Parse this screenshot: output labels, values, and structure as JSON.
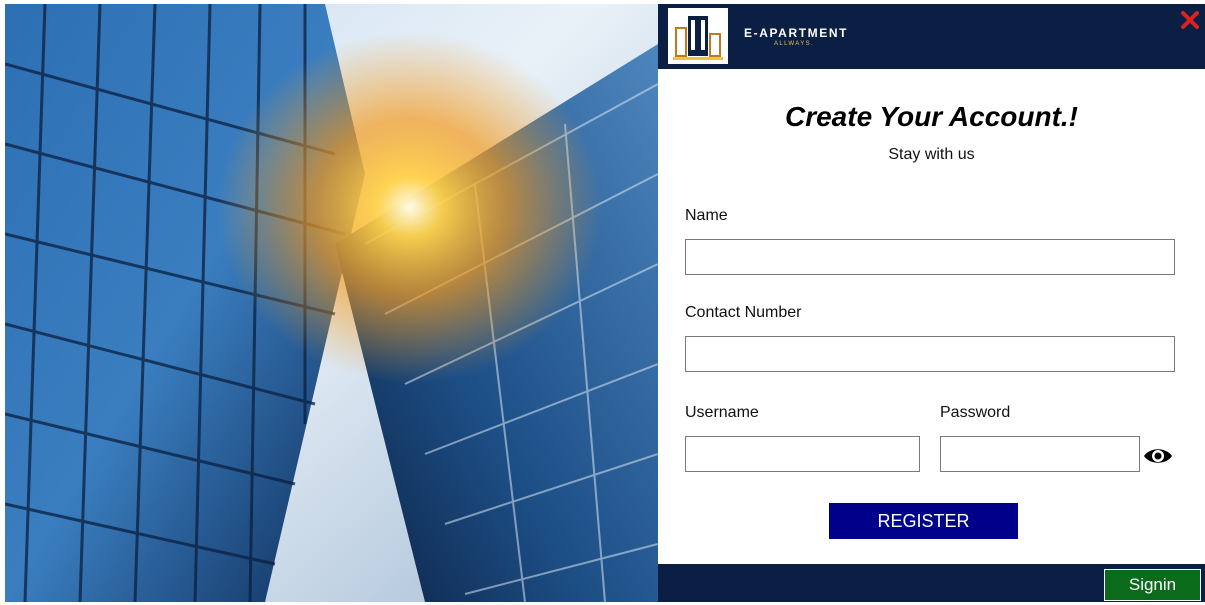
{
  "brand": {
    "name": "E-APARTMENT",
    "tagline": "ALLWAYS."
  },
  "form": {
    "title": "Create Your Account.!",
    "subtitle": "Stay with us",
    "name_label": "Name",
    "name_value": "",
    "contact_label": "Contact Number",
    "contact_value": "",
    "username_label": "Username",
    "username_value": "",
    "password_label": "Password",
    "password_value": "",
    "register_label": "REGISTER"
  },
  "footer": {
    "signin_label": "Signin"
  },
  "colors": {
    "header_bg": "#0b1f44",
    "register_bg": "#00008b",
    "signin_bg": "#0a6b1a",
    "close": "#e02020",
    "tagline": "#e8c547"
  },
  "icons": {
    "close": "close-icon",
    "eye": "eye-icon",
    "logo": "building-logo-icon"
  }
}
